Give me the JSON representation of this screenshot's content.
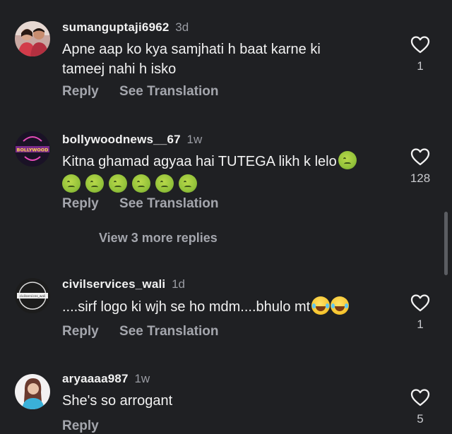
{
  "comments": [
    {
      "username": "sumanguptaji6962",
      "age": "3d",
      "text_line1": "Apne aap ko kya samjhati h baat karne ki",
      "text_line2": "tameej nahi h isko",
      "likes": "1",
      "reply_label": "Reply",
      "translate_label": "See Translation",
      "avatar_icon": "couple-photo-avatar"
    },
    {
      "username": "bollywoodnews__67",
      "age": "1w",
      "text": "Kitna ghamad agyaa hai TUTEGA likh k lelo",
      "emoji_icon": "nauseated-face-emoji",
      "emoji_count": 7,
      "likes": "128",
      "reply_label": "Reply",
      "translate_label": "See Translation",
      "view_replies_label": "View 3 more replies",
      "avatar_icon": "bollywood-logo-avatar",
      "avatar_text": "BOLLYWOOD"
    },
    {
      "username": "civilservices_wali",
      "age": "1d",
      "text": "....sirf logo ki wjh se ho mdm....bhulo mt",
      "emoji_icon": "tears-of-joy-emoji",
      "emoji_count": 2,
      "likes": "1",
      "reply_label": "Reply",
      "translate_label": "See Translation",
      "avatar_icon": "civilservices-logo-avatar",
      "avatar_text": "civilservices_wali"
    },
    {
      "username": "aryaaaa987",
      "age": "1w",
      "text": "She's so arrogant",
      "likes": "5",
      "reply_label": "Reply",
      "avatar_icon": "woman-portrait-avatar"
    }
  ],
  "colors": {
    "background": "#1f2023",
    "primary_text": "#f2f2f2",
    "secondary_text": "#a4a6ad",
    "heart_stroke": "#f2f2f2"
  }
}
